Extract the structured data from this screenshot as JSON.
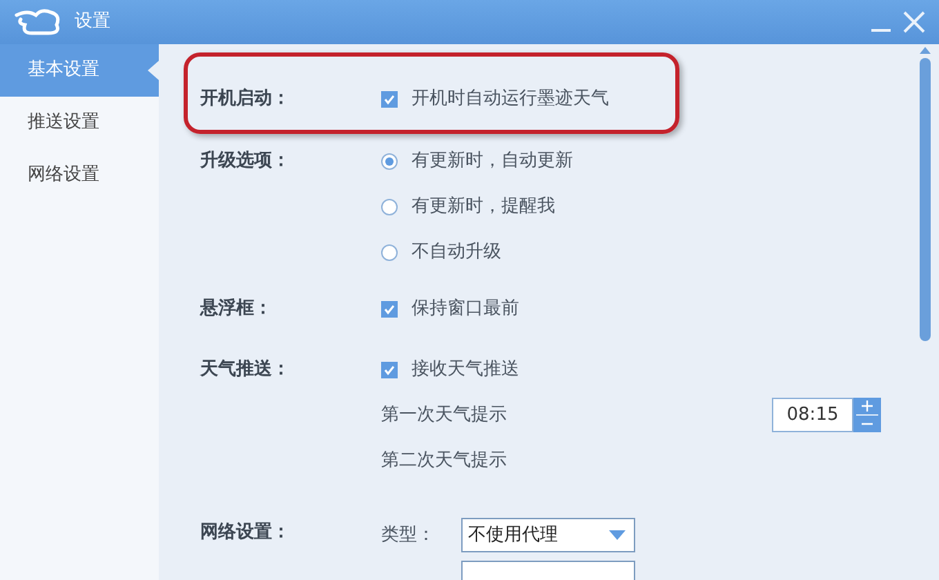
{
  "window": {
    "title": "设置"
  },
  "sidebar": {
    "items": [
      {
        "label": "基本设置",
        "selected": true
      },
      {
        "label": "推送设置",
        "selected": false
      },
      {
        "label": "网络设置",
        "selected": false
      }
    ]
  },
  "sections": [
    {
      "label": "开机启动：",
      "highlighted": true,
      "options": [
        {
          "kind": "checkbox",
          "text": "开机时自动运行墨迹天气",
          "checked": true
        }
      ]
    },
    {
      "label": "升级选项：",
      "options": [
        {
          "kind": "radio",
          "text": "有更新时，自动更新",
          "selected": true
        },
        {
          "kind": "radio",
          "text": "有更新时，提醒我",
          "selected": false
        },
        {
          "kind": "radio",
          "text": "不自动升级",
          "selected": false
        }
      ]
    },
    {
      "label": "悬浮框：",
      "options": [
        {
          "kind": "checkbox",
          "text": "保持窗口最前",
          "checked": true
        }
      ]
    },
    {
      "label": "天气推送：",
      "options": [
        {
          "kind": "checkbox",
          "text": "接收天气推送",
          "checked": true
        },
        {
          "kind": "time",
          "text": "第一次天气提示",
          "value": "08:15"
        },
        {
          "kind": "plain",
          "text": "第二次天气提示"
        }
      ]
    },
    {
      "label": "网络设置：",
      "options": [
        {
          "kind": "select",
          "text": "类型：",
          "value": "不使用代理"
        },
        {
          "kind": "field"
        }
      ]
    }
  ]
}
